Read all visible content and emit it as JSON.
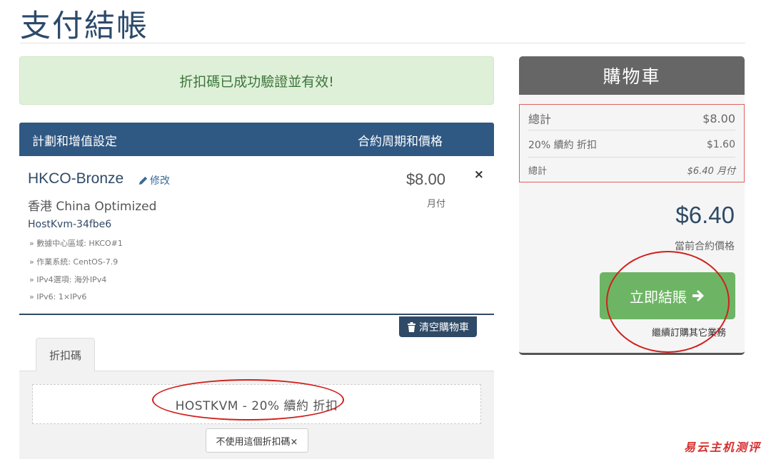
{
  "page": {
    "title": "支付結帳"
  },
  "alert": {
    "message": "折扣碼已成功驗證並有效!"
  },
  "cart_table": {
    "header_left": "計劃和增值設定",
    "header_right": "合約周期和價格"
  },
  "item": {
    "name": "HKCO-Bronze",
    "edit_label": "修改",
    "location": "香港 China Optimized",
    "hostname": "HostKvm-34fbe6",
    "options": [
      "» 數據中心區域: HKCO#1",
      "» 作業系統: CentOS-7.9",
      "» IPv4選項: 海外IPv4",
      "» IPv6: 1×IPv6"
    ],
    "price": "$8.00",
    "cycle": "月付",
    "remove_glyph": "×"
  },
  "empty_cart": {
    "label": "清空購物車"
  },
  "promo": {
    "tab_label": "折扣碼",
    "code_text": "HOSTKVM - 20% 續約 折扣",
    "remove_label": "不使用這個折扣碼×"
  },
  "summary": {
    "title": "購物車",
    "subtotal_label": "總計",
    "subtotal_value": "$8.00",
    "discount_label": "20% 續約 折扣",
    "discount_value": "$1.60",
    "total_label": "總計",
    "total_value": "$6.40 月付",
    "grand_total": "$6.40",
    "grand_label": "當前合約價格",
    "checkout_label": "立即結賬",
    "continue_label": "繼續訂購其它業務"
  },
  "watermark": {
    "text": "易云主机测评"
  },
  "colors": {
    "primary": "#2f5883",
    "success_bg": "#dff0d8",
    "checkout_green": "#6db564",
    "annotation_red": "#d0201c"
  }
}
